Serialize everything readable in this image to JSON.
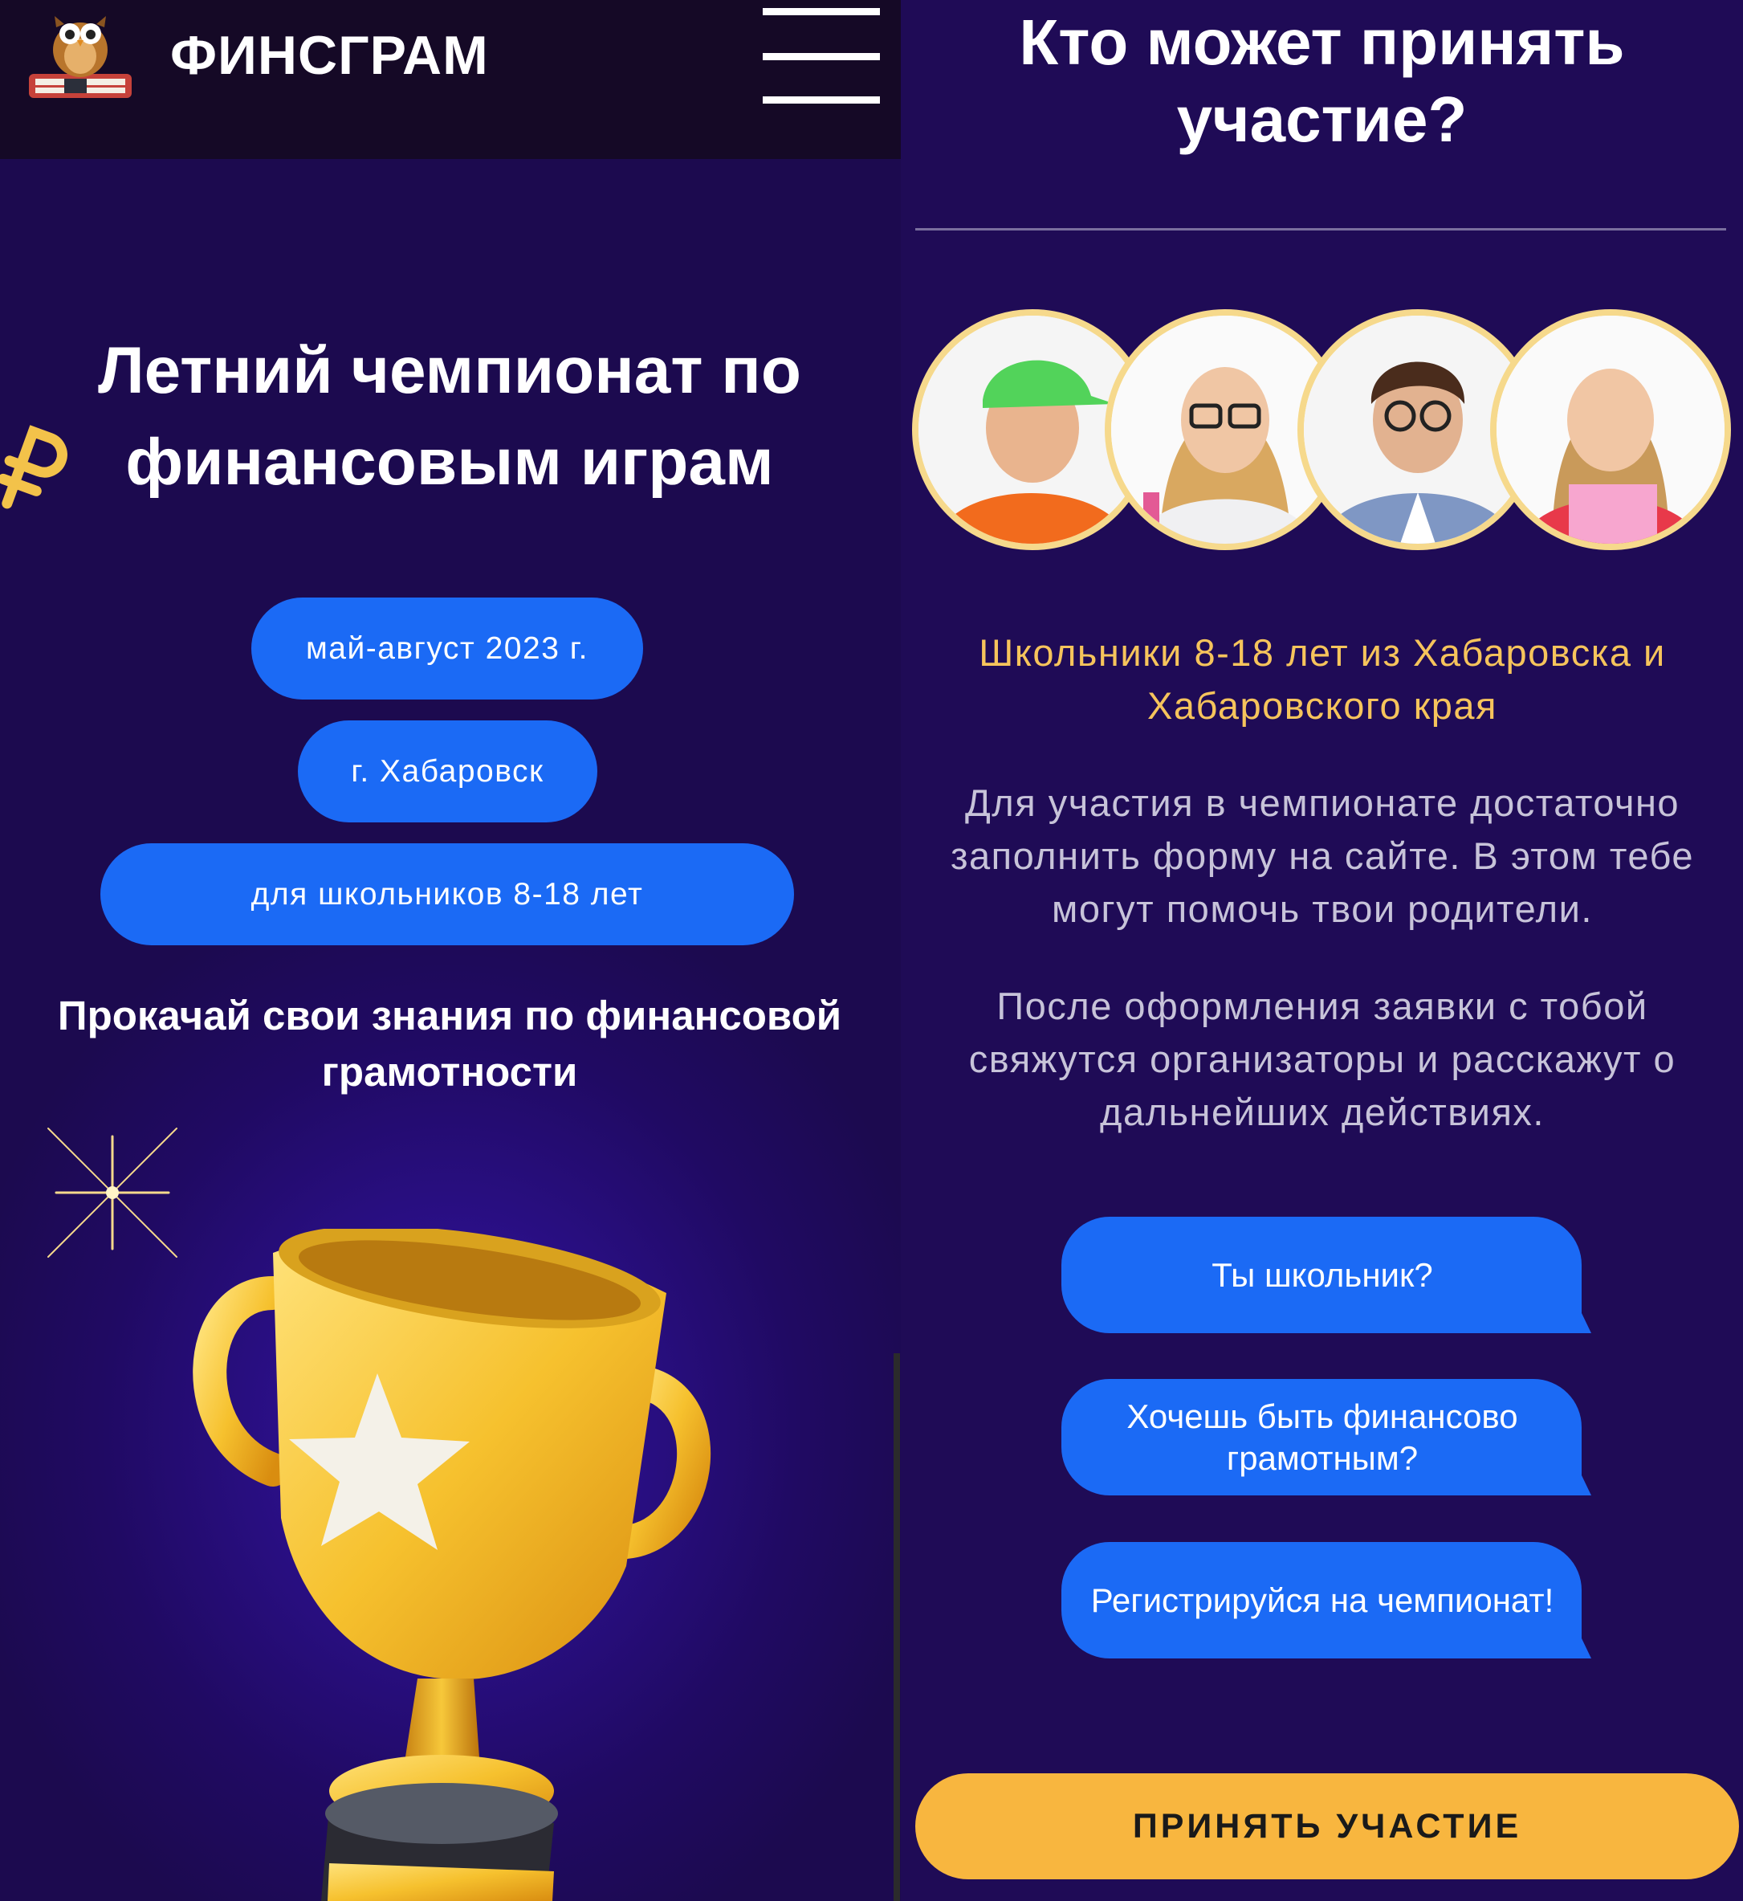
{
  "header": {
    "brand": "ФИНСГРАМ"
  },
  "hero": {
    "title_line1": "Летний чемпионат по",
    "title_line2": "финансовым играм",
    "pills": [
      "май-август 2023 г.",
      "г. Хабаровск",
      "для школьников 8-18 лет"
    ],
    "tagline": "Прокачай свои знания по финансовой грамотности"
  },
  "participants": {
    "title_line1": "Кто может принять",
    "title_line2": "участие?",
    "subtitle": "Школьники 8-18 лет из Хабаровска и Хабаровского края",
    "paragraph1": "Для участия в чемпионате достаточно заполнить форму на сайте. В этом тебе могут помочь твои родители.",
    "paragraph2": "После оформления заявки с тобой свяжутся организаторы и расскажут о дальнейших действиях.",
    "bubbles": [
      "Ты школьник?",
      "Хочешь быть финансово грамотным?",
      "Регистрируйся на чемпионат!"
    ],
    "cta": "ПРИНЯТЬ УЧАСТИЕ"
  },
  "colors": {
    "background": "#1f0b56",
    "topbar": "#150926",
    "accent_blue": "#1b6af5",
    "accent_gold": "#f8b63f",
    "subtitle_gold": "#f6c45c"
  },
  "icons": [
    "owl-book-logo-icon",
    "hamburger-menu-icon",
    "ruble-icon",
    "sparkle-icon",
    "trophy-icon"
  ]
}
